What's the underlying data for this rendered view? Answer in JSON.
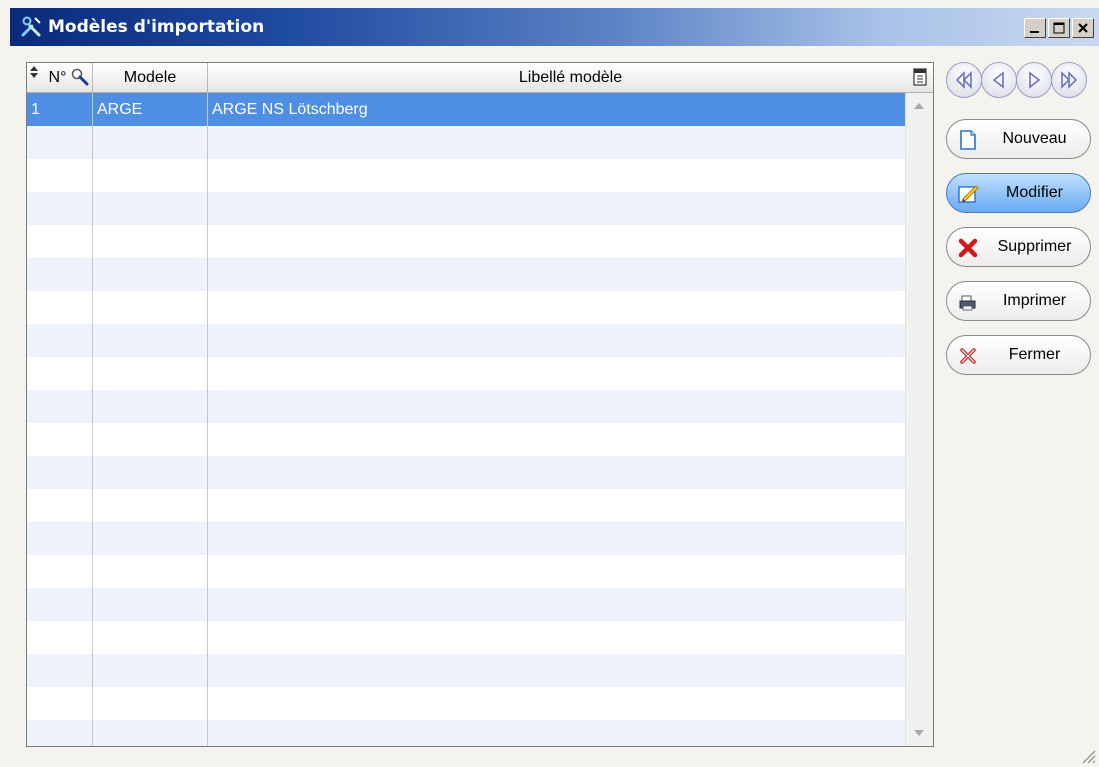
{
  "window": {
    "title": "Modèles d'importation",
    "icon": "tools-icon",
    "controls": [
      "minimize-icon",
      "maximize-icon",
      "close-icon"
    ]
  },
  "grid": {
    "columns": [
      {
        "label": "N°",
        "icons": [
          "sort-icon",
          "search-icon"
        ]
      },
      {
        "label": "Modele"
      },
      {
        "label": "Libellé modèle",
        "icons": [
          "columns-icon"
        ]
      }
    ],
    "rows": [
      {
        "num": "1",
        "modele": "ARGE",
        "libelle": "ARGE NS Lötschberg",
        "selected": true
      }
    ],
    "selection_color": "#4f8fe3",
    "alt_row_color": "#eef3fb"
  },
  "navigation": [
    "first-record-icon",
    "previous-record-icon",
    "next-record-icon",
    "last-record-icon"
  ],
  "buttons": {
    "nouveau": {
      "label": "Nouveau",
      "icon": "new-document-icon"
    },
    "modifier": {
      "label": "Modifier",
      "icon": "edit-icon"
    },
    "supprimer": {
      "label": "Supprimer",
      "icon": "delete-icon"
    },
    "imprimer": {
      "label": "Imprimer",
      "icon": "printer-icon"
    },
    "fermer": {
      "label": "Fermer",
      "icon": "close-icon"
    }
  },
  "colors": {
    "title_start": "#0a2a7a",
    "title_end": "#c9d8ef",
    "active_button": "#6aaaf2"
  }
}
